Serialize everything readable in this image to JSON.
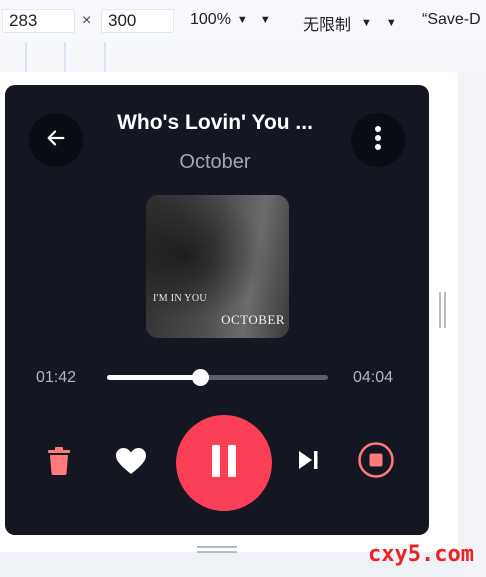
{
  "toolbar": {
    "width": "283",
    "times": "×",
    "height": "300",
    "zoom": "100%",
    "throttle": "无限制",
    "save": "“Save-D"
  },
  "player": {
    "title": "Who's Lovin' You ...",
    "artist": "October",
    "cover": {
      "text_small": "I'M IN YOU",
      "text_big": "OCTOBER"
    },
    "elapsed": "01:42",
    "duration": "04:04",
    "progress_fraction": 0.42,
    "accent_color": "#fb3f57",
    "delete_color": "#ff7a7a"
  },
  "icons": {
    "back": "arrow-left-icon",
    "menu": "more-vertical-icon",
    "delete": "trash-icon",
    "like": "heart-icon",
    "pause": "pause-icon",
    "next": "skip-next-icon",
    "stop": "stop-icon"
  },
  "watermark": "cxy5.com"
}
